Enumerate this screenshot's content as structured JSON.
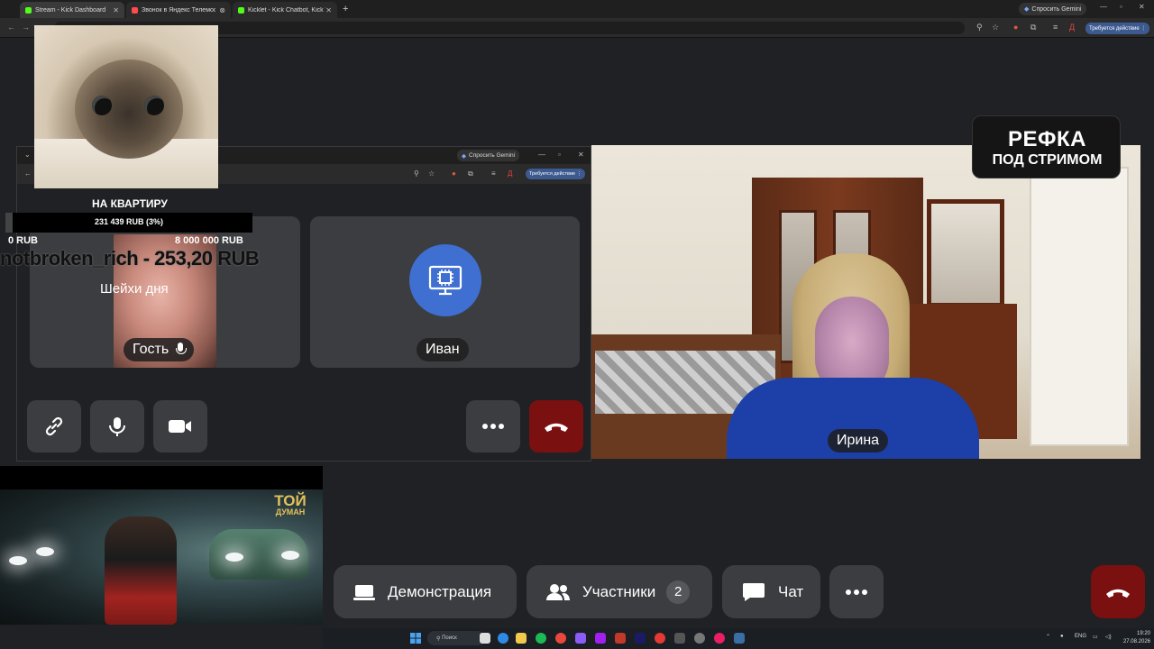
{
  "browser": {
    "tabs": [
      {
        "label": "Stream - Kick Dashboard",
        "color": "#53fc18"
      },
      {
        "label": "Звонок в Яндекс Телемос",
        "color": "#ff4b4b"
      },
      {
        "label": "Kicklet - Kick Chatbot, Kick Wid",
        "color": "#53fc18"
      }
    ],
    "gemini_chip": "Спросить Gemini",
    "action_required": "Требуется действие",
    "profile_initial": "Д"
  },
  "inner_browser": {
    "gemini_chip": "Спросить Gemini",
    "action_required": "Требуется действие"
  },
  "goal": {
    "title": "НА КВАРТИРУ",
    "progress_text": "231 439 RUB (3%)",
    "progress_fraction": 0.03,
    "min_label": "0 RUB",
    "max_label": "8 000 000 RUB",
    "last_donation": "notbroken_rich - 253,20 RUB"
  },
  "call": {
    "guest_caption": "Шейхи дня",
    "guest_name": "Гость",
    "ivan_name": "Иван",
    "irina_name": "Ирина"
  },
  "stream_badge": {
    "line1": "РЕФКА",
    "line2": "ПОД СТРИМОМ"
  },
  "music_video": {
    "logo_line1": "ТОЙ",
    "logo_line2": "ДУМАН"
  },
  "toolbar": {
    "demo_label": "Демонстрация",
    "participants_label": "Участники",
    "participants_count": "2",
    "chat_label": "Чат"
  },
  "taskbar": {
    "search_label": "Поиск",
    "language": "ENG",
    "time": "19:20",
    "date": "27.08.2026"
  },
  "colors": {
    "end_call": "#7a1010",
    "accent_blue": "#3f6fd1",
    "action_chip": "#3c5a8f"
  }
}
